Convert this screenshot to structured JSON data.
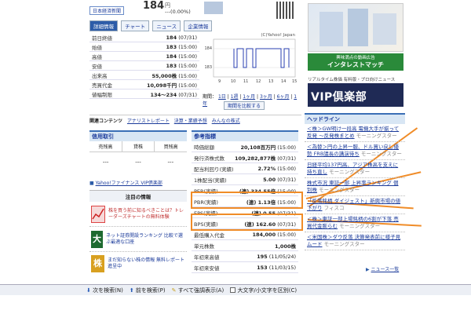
{
  "top": {
    "badge": "日本経済新聞",
    "price_big": "184",
    "price_suffix": "円",
    "change": "---(0.00%)"
  },
  "tabs": [
    {
      "label": "詳細情報",
      "active": true
    },
    {
      "label": "チャート",
      "active": false
    },
    {
      "label": "ニュース",
      "active": false
    },
    {
      "label": "企業情報",
      "active": false
    }
  ],
  "quote": [
    {
      "k": "前日終値",
      "v": "184",
      "t": "(07/31)"
    },
    {
      "k": "始値",
      "v": "183",
      "t": "(15:00)"
    },
    {
      "k": "高値",
      "v": "184",
      "t": "(15:00)"
    },
    {
      "k": "安値",
      "v": "183",
      "t": "(15:00)"
    },
    {
      "k": "出来高",
      "v": "55,000株",
      "t": "(15:00)"
    },
    {
      "k": "売買代金",
      "v": "10,098千円",
      "t": "(15:00)"
    },
    {
      "k": "値幅制限",
      "v": "134〜234",
      "t": "(07/31)"
    }
  ],
  "chart": {
    "caption": "(C)Yahoo! Japan",
    "range_label": "期間：",
    "ranges": [
      "1日",
      "1週",
      "1ヶ月",
      "3ヶ月",
      "6ヶ月",
      "1年"
    ],
    "compare": "期間を比較する",
    "xticks": [
      "9",
      "10",
      "11",
      "12",
      "13",
      "14",
      "15"
    ],
    "yticks": [
      "184",
      "183"
    ]
  },
  "related": {
    "title": "関連コンテンツ",
    "links": [
      "アナリストレポート",
      "決算・業績予想",
      "みんなの株式"
    ]
  },
  "credit": {
    "title": "信用取引",
    "cols": [
      "売残高",
      "貸株",
      "買残高"
    ],
    "vals": [
      "---",
      "---",
      "---"
    ]
  },
  "notice_link": "Yahoo!ファイナンス VIP倶楽部",
  "ads": {
    "title": "注目の情報",
    "items": [
      {
        "text": "株を買う前に知るべきことは？トレーダーズチャートの無料体験",
        "icon": "chart-icon"
      },
      {
        "text": "ネット証券開設ランキング 比較で選ぶ最適な口座",
        "icon": "badge-icon"
      },
      {
        "text": "まだ知らない株の情報 無料レポート進呈中",
        "icon": "stock-icon"
      }
    ]
  },
  "ref": {
    "title": "参考指標",
    "rows": [
      {
        "k": "時価総額",
        "v": "20,108百万円",
        "t": "(15:00)"
      },
      {
        "k": "発行済株式数",
        "v": "109,282,877株",
        "t": "(07/31)"
      },
      {
        "k": "配当利回り(実績)",
        "v": "2.72%",
        "t": "(15:00)"
      },
      {
        "k": "1株配当(実績)",
        "v": "5.00",
        "t": "(07/31)"
      },
      {
        "k": "PER(実績)",
        "v": "(連) 334.55倍",
        "t": "(15:00)"
      },
      {
        "k": "PBR(実績)",
        "v": "(連) 1.13倍",
        "t": "(15:00)"
      },
      {
        "k": "EPS(実績)",
        "v": "(連) 0.55",
        "t": "(07/31)"
      },
      {
        "k": "BPS(実績)",
        "v": "(連) 162.60",
        "t": "(07/31)"
      },
      {
        "k": "最低購入代金",
        "v": "184,000",
        "t": "(15:00)"
      },
      {
        "k": "単元株数",
        "v": "1,000株",
        "t": ""
      },
      {
        "k": "年初来高値",
        "v": "195",
        "t": "(11/05/24)"
      },
      {
        "k": "年初来安値",
        "v": "153",
        "t": "(11/03/15)"
      }
    ]
  },
  "right": {
    "ad1_title": "興味満点の動画広告",
    "ad1_main": "インタレストマッチ",
    "rt_label": "リアルタイム株価 有料版・プロ向けニュース",
    "vip": "VIP倶楽部",
    "headline_title": "ヘッドライン",
    "news": [
      {
        "text": "＜株＞GW明け一段高 電機大手が揃って反発 ～反発株まとめ",
        "src": "モーニングスター"
      },
      {
        "text": "＜為替＞円の上昇一服、ドル買い戻し優勢 FRB議長の講演待ち",
        "src": "モーニングスター"
      },
      {
        "text": "日経平均137円高、アジア株高を支えに持ち直し",
        "src": "モーニングスター"
      },
      {
        "text": "株式市況 東証一部 上昇率ランキング 個別株",
        "src": "モーニングスター"
      },
      {
        "text": "「反落銘柄 ダイジェスト」新興市場の値下がり",
        "src": "フィスコ"
      },
      {
        "text": "＜株＞東証一部上場銘柄の6割が下落 売買代金膨らむ",
        "src": "モーニングスター"
      },
      {
        "text": "＜米国株＞ダウ反落 決算発表前に様子見ムード",
        "src": "モーニングスター"
      }
    ],
    "more": "ニュース一覧"
  },
  "findbar": {
    "next": "次を検索(N)",
    "prev": "前を検索(P)",
    "highlight": "すべて強調表示(A)",
    "matchcase": "大文字/小文字を区別(C)"
  },
  "colors": {
    "accent": "#3b6fb6",
    "highlight": "#f08c28",
    "vip": "#1f2a55"
  }
}
